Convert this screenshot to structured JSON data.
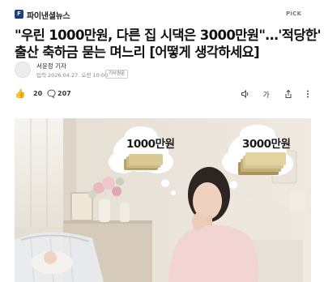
{
  "header": {
    "logo_text": "F",
    "publisher": "파이낸셜뉴스",
    "pick_label": "PiCK"
  },
  "article": {
    "headline_line1": "\"우린 1000만원, 다른 집 시댁은 3000만원\"…'적당한'",
    "headline_line2": "출산 축하금 묻는 며느리 [어떻게 생각하세요]",
    "author": "서윤정 기자",
    "date": "입력 2026.04.27. 오전 10:00",
    "badge": "기사원문"
  },
  "reactions": {
    "like_icon": "thumbs-up-heart-icon",
    "like_count": "20",
    "comment_icon": "speech-bubble-icon",
    "comment_count": "207"
  },
  "tools": [
    "audio-icon",
    "text-size-icon",
    "share-icon",
    "more-icon"
  ],
  "photo": {
    "bubble_left_amount": "1000만원",
    "bubble_right_amount": "3000만원"
  },
  "colors": {
    "logo": "#1a3e8c",
    "wall": "#ece6dc",
    "sweater": "#f2d4d2",
    "money": "#b8a46a"
  }
}
